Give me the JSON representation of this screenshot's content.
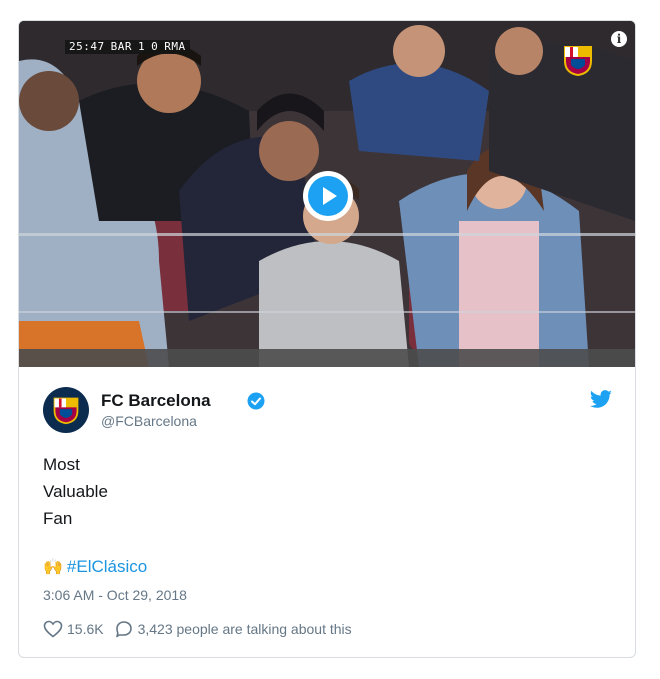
{
  "video": {
    "scorebug": {
      "clock": "25:47",
      "home": "BAR",
      "home_score": "1",
      "away_score": "0",
      "away": "RMA"
    },
    "info_icon": "i",
    "overlay_icon": "fc-barcelona-crest-icon",
    "play_icon": "play-icon"
  },
  "tweet": {
    "display_name": "FC Barcelona",
    "handle": "@FCBarcelona",
    "verified_icon": "verified-badge-icon",
    "platform_icon": "twitter-bird-icon",
    "avatar_icon": "fc-barcelona-crest-icon",
    "text_lines": [
      "Most",
      "Valuable",
      "Fan"
    ],
    "emoji": "🙌",
    "hashtag": "#ElClásico",
    "timestamp": "3:06 AM - Oct 29, 2018",
    "likes": "15.6K",
    "talking": "3,423 people are talking about this"
  },
  "colors": {
    "accent": "#1da1f2",
    "link": "#1b95e0",
    "muted": "#657786",
    "text": "#14171a"
  }
}
